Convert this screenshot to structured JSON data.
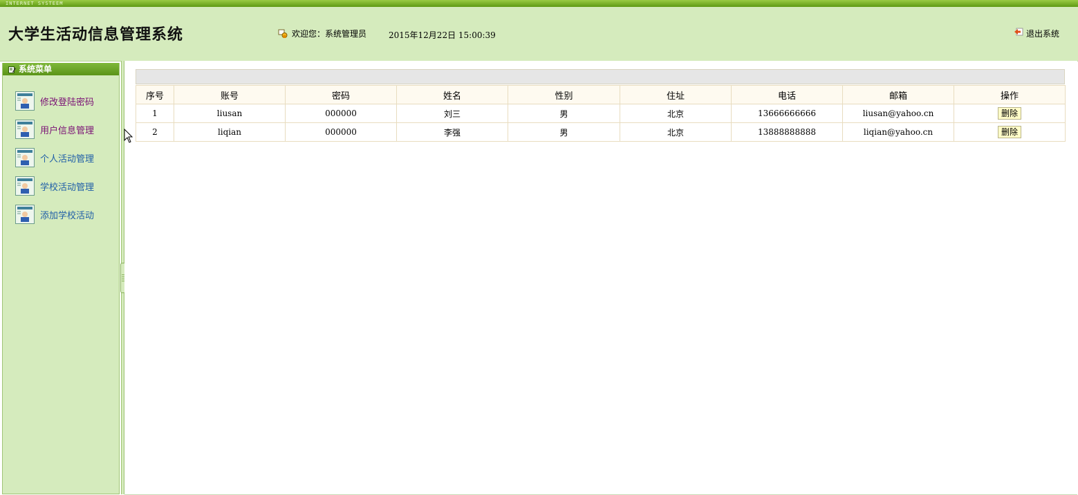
{
  "topbar": {
    "tag": "INTERNET SYSTEEM"
  },
  "header": {
    "title": "大学生活动信息管理系统",
    "welcome": "欢迎您：系统管理员",
    "datetime": "2015年12月22日  15:00:39",
    "logout": "退出系统"
  },
  "sidebar": {
    "title": "系统菜单",
    "items": [
      {
        "label": "修改登陆密码",
        "color": "#7a1075"
      },
      {
        "label": "用户信息管理",
        "color": "#7a1075"
      },
      {
        "label": "个人活动管理",
        "color": "#1f5ea8"
      },
      {
        "label": "学校活动管理",
        "color": "#1f5ea8"
      },
      {
        "label": "添加学校活动",
        "color": "#1f5ea8"
      }
    ]
  },
  "table": {
    "columns": [
      "序号",
      "账号",
      "密码",
      "姓名",
      "性别",
      "住址",
      "电话",
      "邮箱",
      "操作"
    ],
    "rows": [
      [
        "1",
        "liusan",
        "000000",
        "刘三",
        "男",
        "北京",
        "13666666666",
        "liusan@yahoo.cn"
      ],
      [
        "2",
        "liqian",
        "000000",
        "李强",
        "男",
        "北京",
        "13888888888",
        "liqian@yahoo.cn"
      ]
    ],
    "action_label": "删除"
  },
  "colors": {
    "header_bg": "#d5ebbd",
    "accent_green": "#5e9a14",
    "table_header_bg": "#fefaf0",
    "button_bg": "#fffcc8"
  },
  "icons": [
    "user-lock-icon",
    "exit-icon",
    "menu-edit-icon",
    "user-card-icon",
    "mouse-cursor-icon"
  ]
}
